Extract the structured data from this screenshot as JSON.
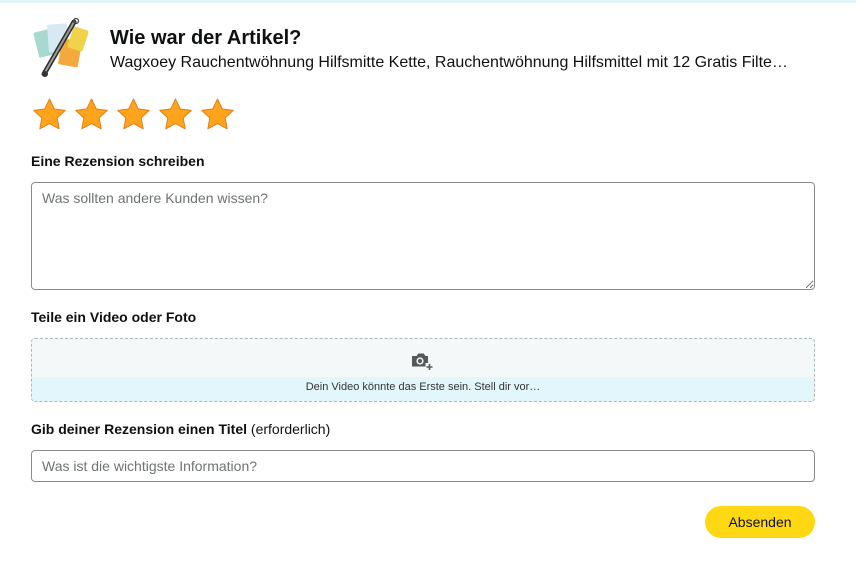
{
  "header": {
    "heading": "Wie war der Artikel?",
    "product_title": "Wagxoey Rauchentwöhnung Hilfsmitte Kette, Rauchentwöhnung Hilfsmittel mit 12 Gratis Filte…",
    "product_image_icon": "product-thumbnail"
  },
  "rating": {
    "value": 5,
    "max": 5,
    "star_color": "#ffa41c"
  },
  "review": {
    "label": "Eine Rezension schreiben",
    "placeholder": "Was sollten andere Kunden wissen?",
    "value": ""
  },
  "media": {
    "label": "Teile ein Video oder Foto",
    "icon": "camera-add-icon",
    "hint": "Dein Video könnte das Erste sein. Stell dir vor…"
  },
  "title_field": {
    "label": "Gib deiner Rezension einen Titel",
    "required_note": "(erforderlich)",
    "placeholder": "Was ist die wichtigste Information?",
    "value": ""
  },
  "actions": {
    "submit_label": "Absenden",
    "submit_color": "#ffd814"
  }
}
